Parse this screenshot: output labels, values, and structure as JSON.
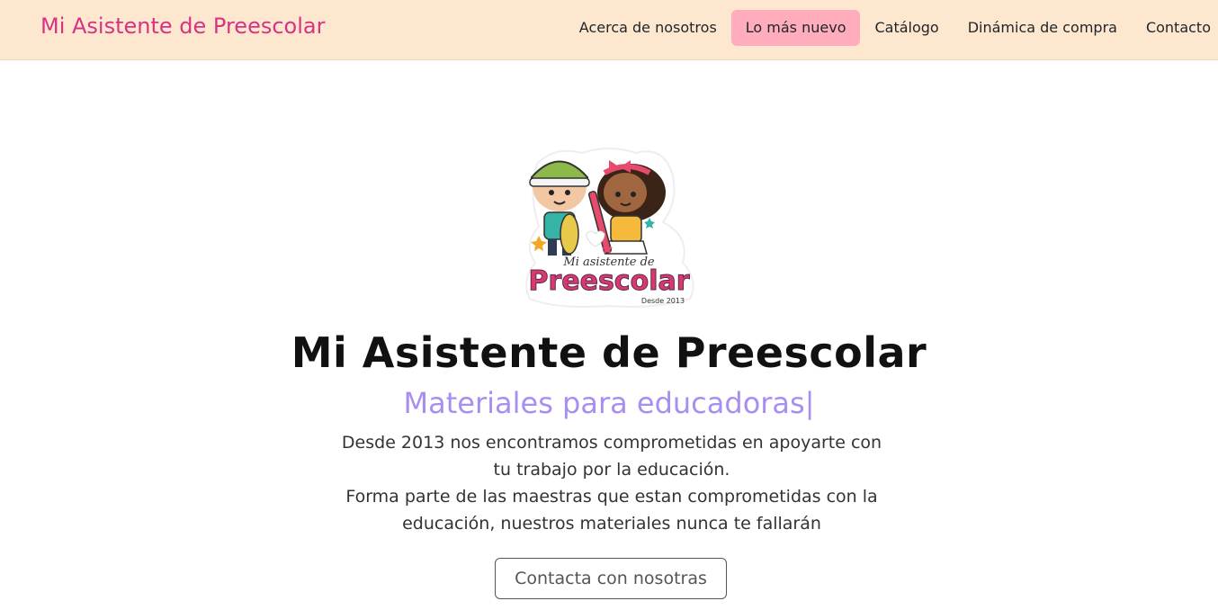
{
  "navbar": {
    "brand": "Mi Asistente de Preescolar",
    "items": [
      {
        "label": "Acerca de nosotros"
      },
      {
        "label": "Lo más nuevo",
        "active": true
      },
      {
        "label": "Catálogo"
      },
      {
        "label": "Dinámica de compra"
      },
      {
        "label": "Contacto"
      }
    ]
  },
  "hero": {
    "logo_text_line1": "Mi asistente de",
    "logo_text_line2": "Preescolar",
    "logo_text_line3": "Desde 2013",
    "title": "Mi Asistente de Preescolar",
    "subtitle": "Materiales para educadoras|",
    "description_line1": "Desde 2013 nos encontramos comprometidas en apoyarte con tu trabajo por la educación.",
    "description_line2": "Forma parte de las maestras que estan comprometidas con la educación, nuestros materiales nunca te fallarán",
    "cta_label": "Contacta con nosotras"
  },
  "colors": {
    "navbar_bg": "#fde8cf",
    "brand": "#d63384",
    "active_nav_bg": "#ffadbc",
    "subtitle": "#a98ef2"
  }
}
